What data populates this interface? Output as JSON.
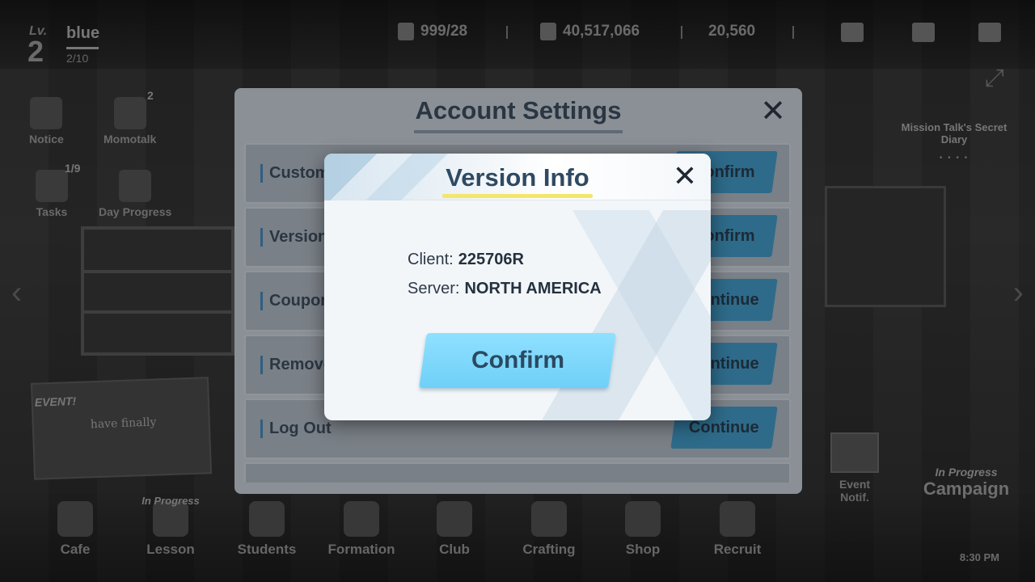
{
  "hud": {
    "level_label": "Lv.",
    "level": "2",
    "player_name": "blue",
    "exp": "2/10",
    "ap": "999/28",
    "credits": "40,517,066",
    "gems": "20,560"
  },
  "side": {
    "notice": "Notice",
    "momotalk": "Momotalk",
    "momotalk_badge": "2",
    "tasks": "Tasks",
    "tasks_badge": "1/9",
    "daily": "Day Progress"
  },
  "event_card": {
    "tag": "EVENT!",
    "text": "have finally"
  },
  "right": {
    "banner": "Mission Talk's Secret Diary",
    "dots": "• • • •",
    "event_notif": "Event Notif.",
    "campaign_tag": "In Progress",
    "campaign": "Campaign"
  },
  "bottom_nav": [
    {
      "label": "Cafe",
      "progress": ""
    },
    {
      "label": "Lesson",
      "progress": "In Progress"
    },
    {
      "label": "Students",
      "progress": ""
    },
    {
      "label": "Formation",
      "progress": ""
    },
    {
      "label": "Club",
      "progress": ""
    },
    {
      "label": "Crafting",
      "progress": ""
    },
    {
      "label": "Shop",
      "progress": ""
    },
    {
      "label": "Recruit",
      "progress": ""
    }
  ],
  "clock": "8:30 PM",
  "account": {
    "title": "Account Settings",
    "rows": [
      {
        "label": "Custom",
        "button": "Confirm"
      },
      {
        "label": "Version",
        "button": "Confirm"
      },
      {
        "label": "Coupon",
        "button": "Continue"
      },
      {
        "label": "Remove",
        "button": "Continue"
      },
      {
        "label": "Log Out",
        "button": "Continue"
      },
      {
        "label": "",
        "button": ""
      }
    ]
  },
  "dialog": {
    "title": "Version Info",
    "client_label": "Client:",
    "client_value": "225706R",
    "server_label": "Server:",
    "server_value": "NORTH AMERICA",
    "confirm": "Confirm"
  }
}
